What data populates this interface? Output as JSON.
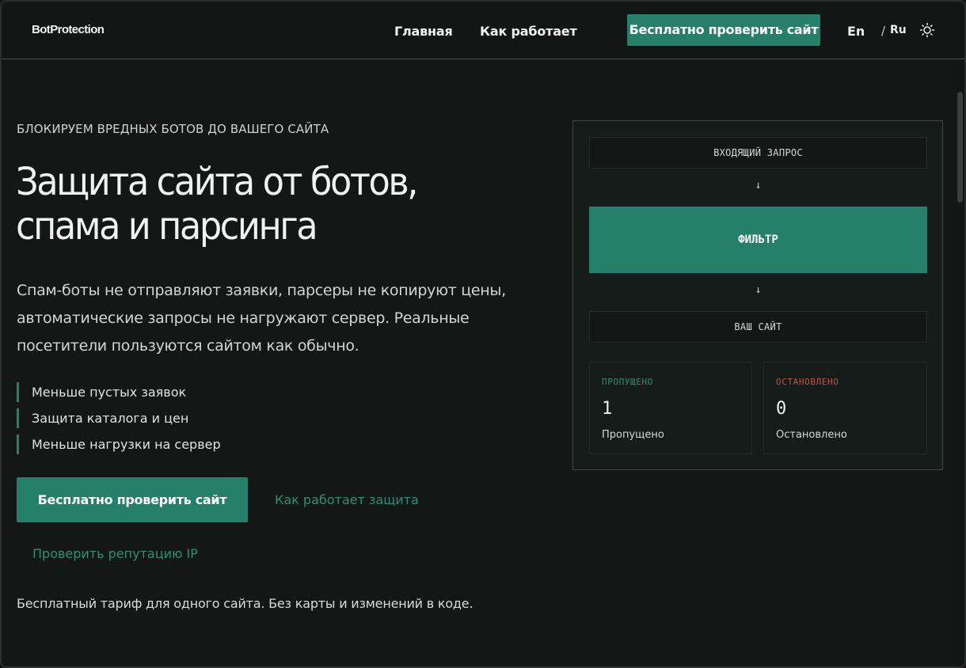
{
  "header": {
    "logo": "BotProtection",
    "nav": {
      "home": "Главная",
      "how": "Как работает"
    },
    "cta": "Бесплатно проверить сайт",
    "lang_en": "En",
    "lang_sep": "/",
    "lang_ru": "Ru",
    "theme_icon": "sun-icon"
  },
  "hero": {
    "eyebrow": "БЛОКИРУЕМ ВРЕДНЫХ БОТОВ ДО ВАШЕГО САЙТА",
    "title_line1": "Защита сайта от ботов,",
    "title_line2": "спама и парсинга",
    "lead": "Спам-боты не отправляют заявки, парсеры не копируют цены, автоматические запросы не нагружают сервер. Реальные посетители пользуются сайтом как обычно.",
    "features": [
      "Меньше пустых заявок",
      "Защита каталога и цен",
      "Меньше нагрузки на сервер"
    ],
    "cta": "Бесплатно проверить сайт",
    "link_how": "Как работает защита",
    "link_ip": "Проверить репутацию IP",
    "note": "Бесплатный тариф для одного сайта. Без карты и изменений в коде."
  },
  "diagram": {
    "incoming": "ВХОДЯЩИЙ ЗАПРОС",
    "arrow": "↓",
    "filter": "ФИЛЬТР",
    "site": "ВАШ САЙТ",
    "passed": {
      "label": "ПРОПУЩЕНО",
      "value": "1",
      "caption": "Пропущено"
    },
    "blocked": {
      "label": "ОСТАНОВЛЕНО",
      "value": "0",
      "caption": "Остановлено"
    }
  },
  "colors": {
    "background": "#131716",
    "accent": "#267f68",
    "link": "#2f8f74",
    "blocked": "#c4543f"
  }
}
